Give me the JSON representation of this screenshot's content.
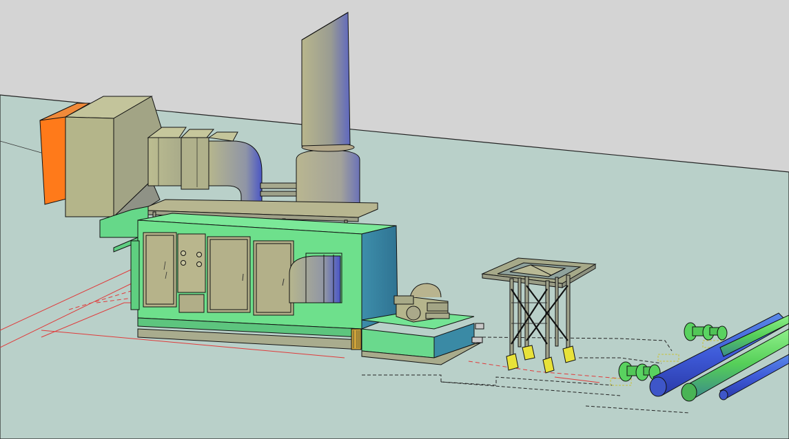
{
  "scene": {
    "colors": {
      "sky": "#d4d4d4",
      "ground": "#b9d0c9",
      "edge": "#111111",
      "enclosure_green": "#6ee08c",
      "enclosure_blue": "#3f8aa6",
      "duct_khaki": "#b4b58a",
      "filter_orange": "#ff7a1a",
      "stack_khaki": "#b7b58f",
      "pipe_blue": "#3f5bd6",
      "pipe_green": "#5ad15a",
      "insulator_green": "#59d25f",
      "foundation_yellow": "#e8e23a",
      "underground_red": "#e03a3a"
    },
    "icons": {
      "gas_turbine_package": "gas-turbine-enclosure-icon",
      "exhaust_stack": "exhaust-stack-icon",
      "air_filter": "air-intake-filter-icon",
      "generator_skid": "generator-skid-icon",
      "transformer_tower": "lattice-tower-icon",
      "busbars": "busbar-pipe-icon"
    }
  }
}
